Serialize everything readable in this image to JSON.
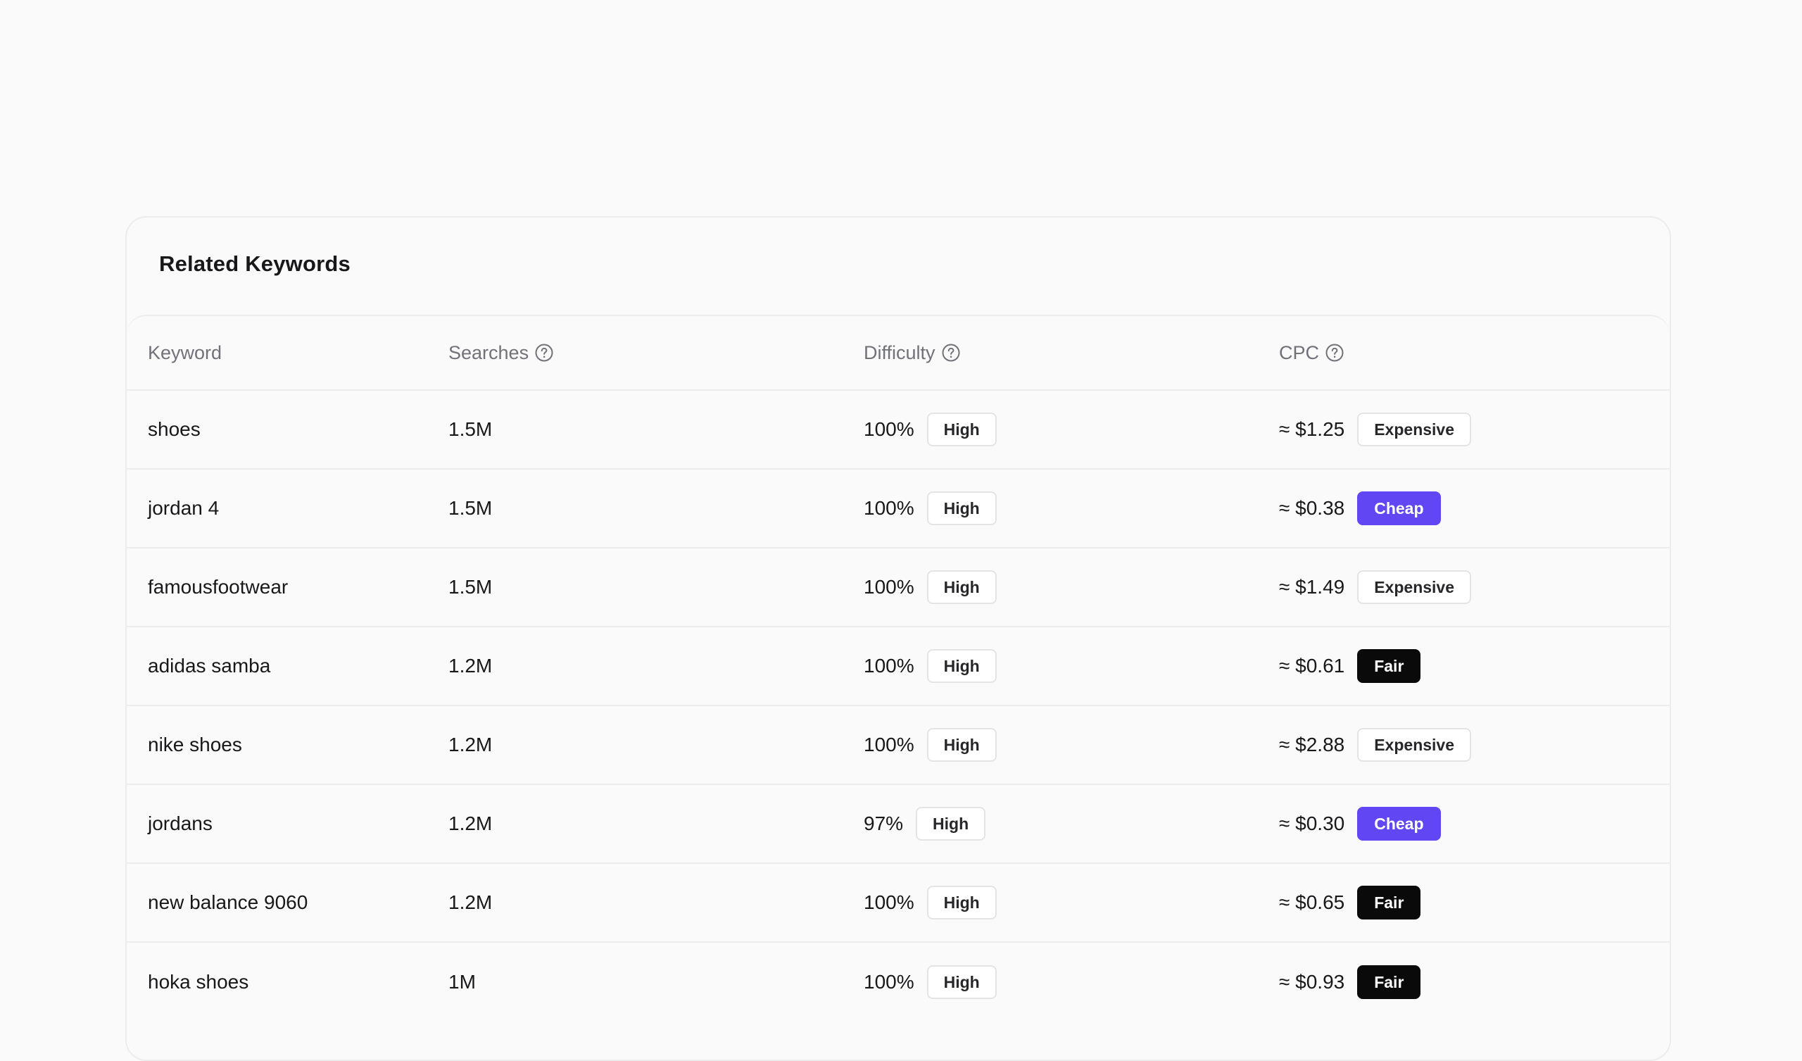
{
  "card": {
    "title": "Related Keywords"
  },
  "table": {
    "columns": [
      {
        "label": "Keyword",
        "has_help": false
      },
      {
        "label": "Searches",
        "has_help": true
      },
      {
        "label": "Difficulty",
        "has_help": true
      },
      {
        "label": "CPC",
        "has_help": true
      }
    ],
    "help_icon": "question-circle-icon",
    "rows": [
      {
        "keyword": "shoes",
        "searches": "1.5M",
        "difficulty": "100%",
        "difficulty_level": "High",
        "cpc": "≈ $1.25",
        "cpc_level": "Expensive"
      },
      {
        "keyword": "jordan 4",
        "searches": "1.5M",
        "difficulty": "100%",
        "difficulty_level": "High",
        "cpc": "≈ $0.38",
        "cpc_level": "Cheap"
      },
      {
        "keyword": "famousfootwear",
        "searches": "1.5M",
        "difficulty": "100%",
        "difficulty_level": "High",
        "cpc": "≈ $1.49",
        "cpc_level": "Expensive"
      },
      {
        "keyword": "adidas samba",
        "searches": "1.2M",
        "difficulty": "100%",
        "difficulty_level": "High",
        "cpc": "≈ $0.61",
        "cpc_level": "Fair"
      },
      {
        "keyword": "nike shoes",
        "searches": "1.2M",
        "difficulty": "100%",
        "difficulty_level": "High",
        "cpc": "≈ $2.88",
        "cpc_level": "Expensive"
      },
      {
        "keyword": "jordans",
        "searches": "1.2M",
        "difficulty": "97%",
        "difficulty_level": "High",
        "cpc": "≈ $0.30",
        "cpc_level": "Cheap"
      },
      {
        "keyword": "new balance 9060",
        "searches": "1.2M",
        "difficulty": "100%",
        "difficulty_level": "High",
        "cpc": "≈ $0.65",
        "cpc_level": "Fair"
      },
      {
        "keyword": "hoka shoes",
        "searches": "1M",
        "difficulty": "100%",
        "difficulty_level": "High",
        "cpc": "≈ $0.93",
        "cpc_level": "Fair"
      }
    ]
  },
  "colors": {
    "page_background": "#fafafa",
    "border": "#ececec",
    "header_text": "#71717a",
    "cheap_badge": "#6147f4",
    "fair_badge": "#0a0a0a",
    "expensive_badge": "#ffffff"
  }
}
